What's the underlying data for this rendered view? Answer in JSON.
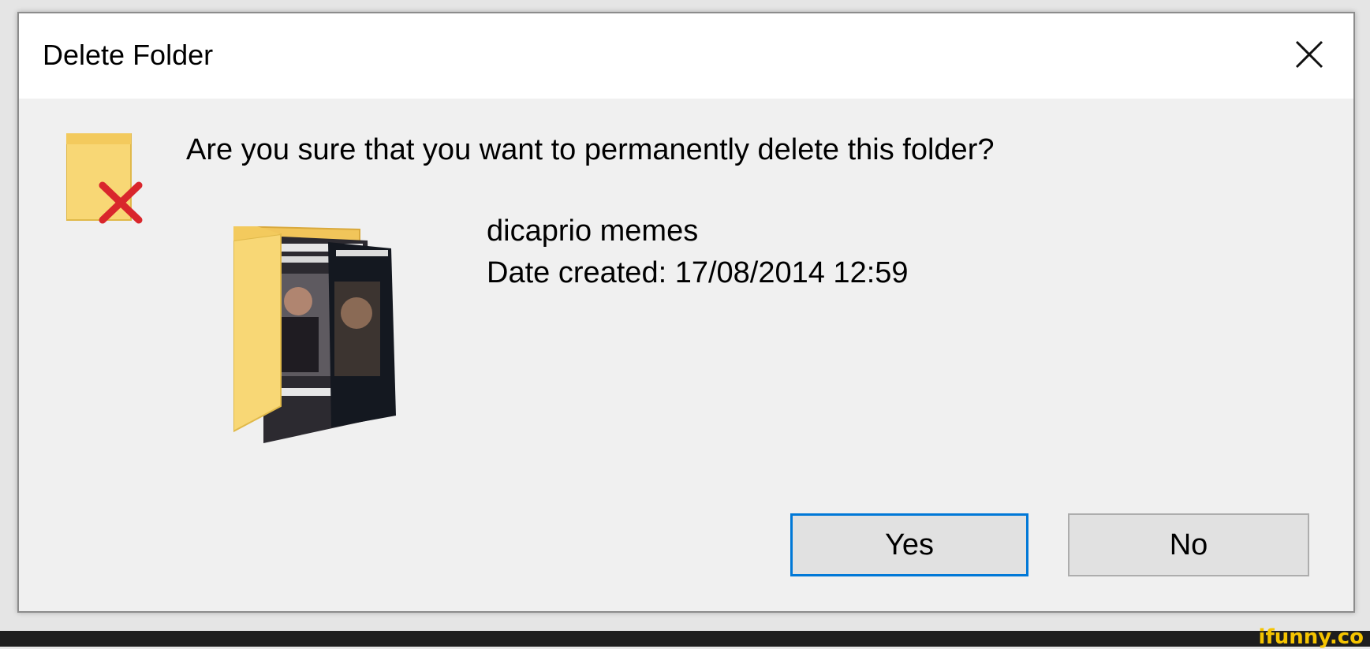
{
  "dialog": {
    "title": "Delete Folder",
    "close_icon": "close-icon",
    "question": "Are you sure that you want to permanently delete this folder?",
    "warning_icon": "folder-delete-icon",
    "folder": {
      "name": "dicaprio memes",
      "date_created": "Date created: 17/08/2014 12:59",
      "thumbnail_icon": "folder-thumbnail-icon"
    },
    "buttons": {
      "yes_label": "Yes",
      "no_label": "No"
    }
  },
  "watermark": {
    "text": "ifunny.co"
  },
  "colors": {
    "dialog_background": "#f0f0f0",
    "titlebar_background": "#ffffff",
    "focus_border": "#0078d7",
    "button_background": "#e1e1e1",
    "folder_yellow": "#f8d775",
    "delete_red": "#d9262c",
    "watermark_yellow": "#f5c400"
  }
}
